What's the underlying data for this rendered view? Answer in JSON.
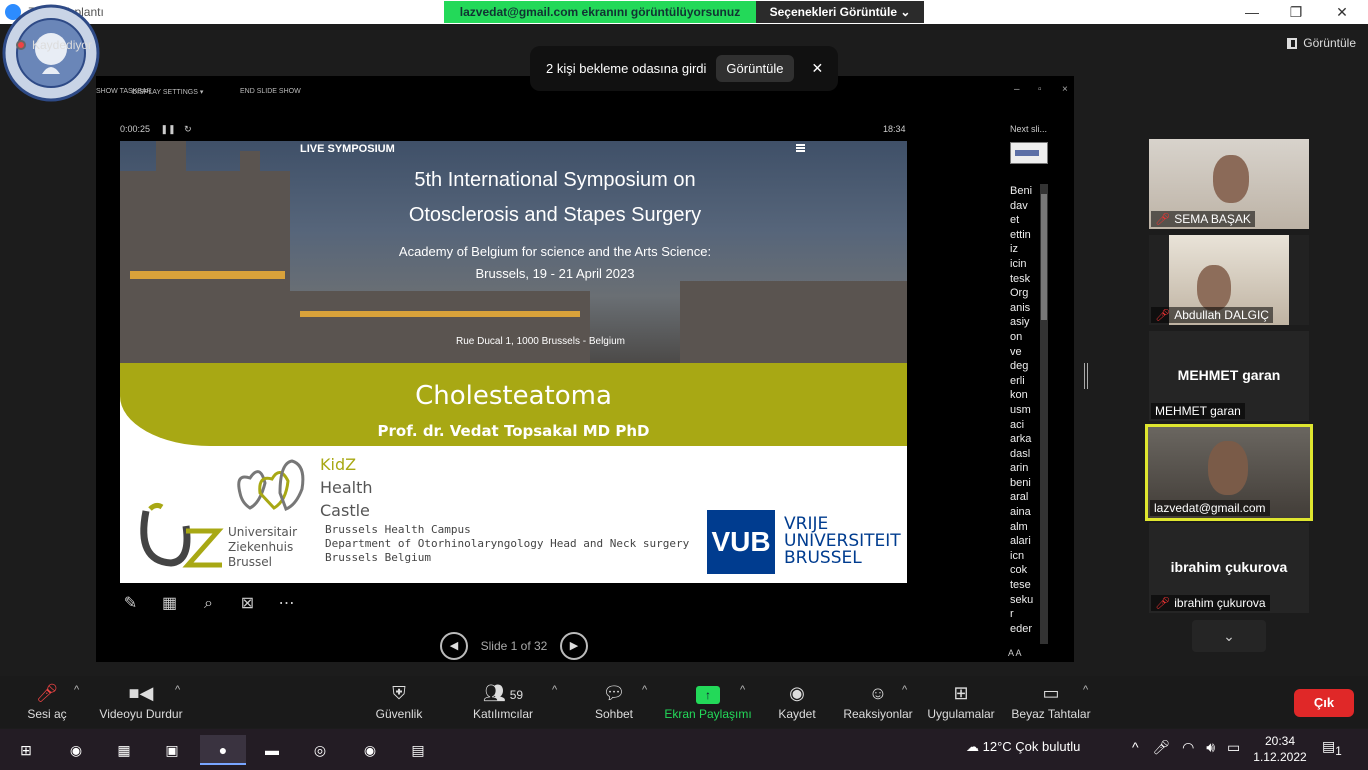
{
  "window": {
    "title": "Zoom Toplantı",
    "minimize": "—",
    "restore": "❐",
    "close": "✕"
  },
  "share_banner": {
    "text": "lazvedat@gmail.com  ekranını görüntülüyorsunuz",
    "view_options": "Seçenekleri Görüntüle ⌄"
  },
  "recording": {
    "label": "Kaydediyor"
  },
  "view_button": {
    "label": "Görüntüle"
  },
  "waiting_toast": {
    "message": "2 kişi bekleme odasına girdi",
    "view": "Görüntüle",
    "close": "✕"
  },
  "presenter": {
    "show_taskbar": "SHOW TASKBAR",
    "display_settings": "DISPLAY SETTINGS ▾",
    "end_slide_show": "END SLIDE SHOW",
    "timer": "0:00:25",
    "clock": "18:34",
    "next_slide_label": "Next sli...",
    "notes": [
      "Beni",
      "dav",
      "et",
      "ettin",
      "iz",
      "icin",
      "tesk",
      "Org",
      "anis",
      "asiy",
      "on",
      "ve",
      "deg",
      "erli",
      "kon",
      "usm",
      "aci",
      "arka",
      "dasl",
      "arin",
      "beni",
      "aral",
      "aina",
      "alm",
      "alari",
      "icn",
      "cok",
      "tese",
      "seku",
      "r",
      "eder"
    ],
    "notes_zoom": "A  A",
    "slide_counter": "Slide 1 of 32"
  },
  "slide": {
    "live_label": "LIVE SYMPOSIUM",
    "title_line1": "5th International Symposium on",
    "title_line2": "Otosclerosis and Stapes Surgery",
    "sub_line1": "Academy of Belgium for science and the Arts Science:",
    "sub_line2": "Brussels, 19 - 21 April 2023",
    "address": "Rue Ducal 1, 1000 Brussels - Belgium",
    "main_title": "Cholesteatoma",
    "author": "Prof. dr. Vedat Topsakal MD PhD",
    "kidz_1": "KidZ",
    "kidz_2": "Health",
    "kidz_3": "Castle",
    "uz_1": "Universitair",
    "uz_2": "Ziekenhuis",
    "uz_3": "Brussel",
    "campus_1": "Brussels Health Campus",
    "campus_2": "Department of Otorhinolaryngology Head and Neck surgery",
    "campus_3": "Brussels Belgium",
    "vub_logo": "VUB",
    "vub_1": "VRIJE",
    "vub_2": "UNIVERSITEIT",
    "vub_3": "BRUSSEL"
  },
  "participants": [
    {
      "name": "SEMA BAŞAK",
      "muted": true
    },
    {
      "name": "Abdullah DALGIÇ",
      "muted": true
    },
    {
      "name": "MEHMET garan",
      "muted": false
    },
    {
      "name": "lazvedat@gmail.com",
      "muted": false
    },
    {
      "name": "ibrahim çukurova",
      "muted": true
    }
  ],
  "toolbar": {
    "audio": "Sesi aç",
    "video": "Videoyu Durdur",
    "security": "Güvenlik",
    "participants": "Katılımcılar",
    "participant_count": "59",
    "chat": "Sohbet",
    "share": "Ekran Paylaşımı",
    "record": "Kaydet",
    "reactions": "Reaksiyonlar",
    "apps": "Uygulamalar",
    "whiteboards": "Beyaz Tahtalar",
    "exit": "Çık"
  },
  "taskbar": {
    "weather": "12°C  Çok bulutlu",
    "time": "20:34",
    "date": "1.12.2022",
    "notifications": "1"
  },
  "colors": {
    "share_green": "#23d959",
    "slide_band": "#a8a814",
    "vub_blue": "#003c8f",
    "exit_red": "#e02828",
    "active_speaker": "#dfe62f"
  }
}
